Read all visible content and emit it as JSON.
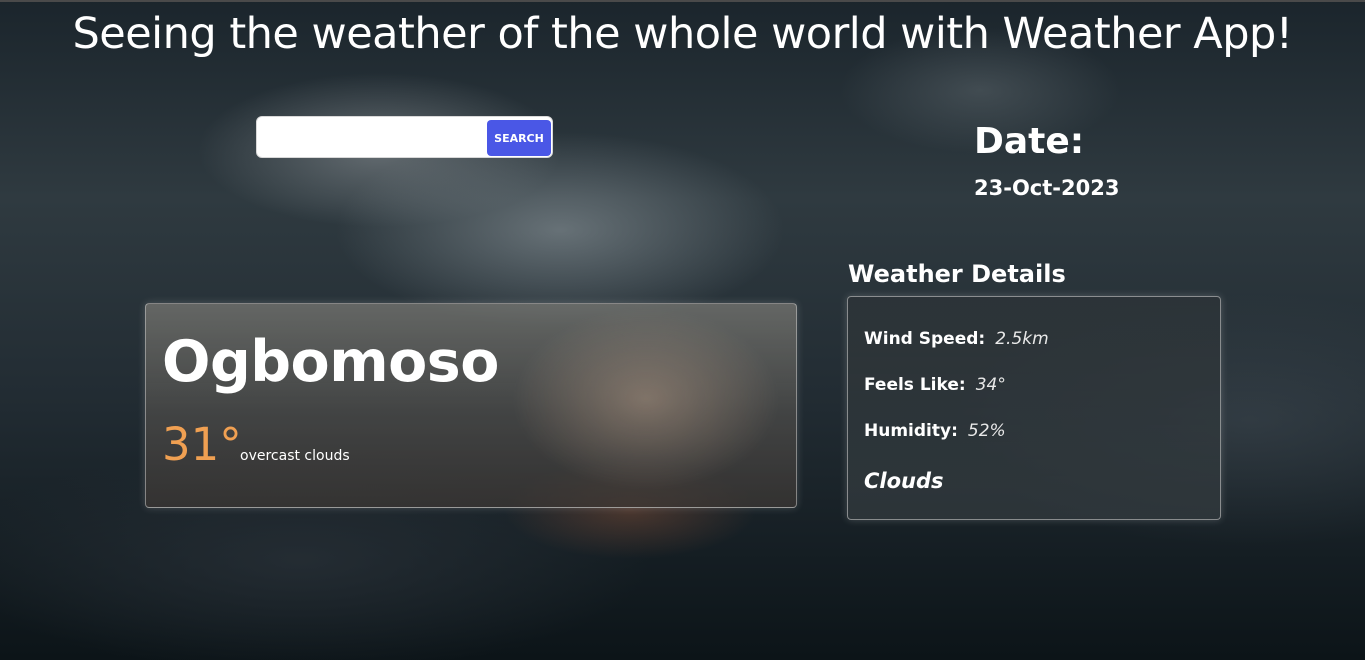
{
  "header": {
    "title": "Seeing the weather of the whole world with Weather App!"
  },
  "search": {
    "value": "",
    "placeholder": "",
    "button_label": "SEARCH"
  },
  "date": {
    "label": "Date:",
    "value": "23-Oct-2023"
  },
  "current": {
    "city": "Ogbomoso",
    "temperature": "31°",
    "description": "overcast clouds"
  },
  "details": {
    "heading": "Weather Details",
    "wind_label": "Wind Speed:",
    "wind_value": "2.5km",
    "feels_label": "Feels Like:",
    "feels_value": "34°",
    "humidity_label": "Humidity:",
    "humidity_value": "52%",
    "main": "Clouds"
  },
  "colors": {
    "accent_button": "#4a57e6",
    "temperature": "#f0a052"
  }
}
